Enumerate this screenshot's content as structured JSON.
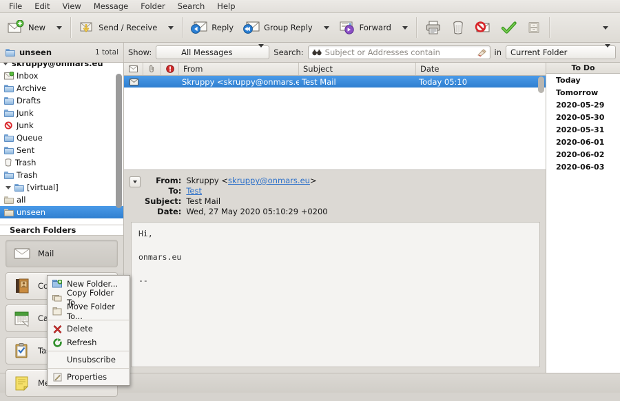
{
  "menubar": {
    "items": [
      {
        "label": "File"
      },
      {
        "label": "Edit"
      },
      {
        "label": "View"
      },
      {
        "label": "Message"
      },
      {
        "label": "Folder"
      },
      {
        "label": "Search"
      },
      {
        "label": "Help"
      }
    ]
  },
  "toolbar": {
    "new_label": "New",
    "send_receive_label": "Send / Receive",
    "reply_label": "Reply",
    "group_reply_label": "Group Reply",
    "forward_label": "Forward",
    "icons": {
      "new": "new-message-icon",
      "send_receive": "send-receive-icon",
      "reply": "reply-icon",
      "group_reply": "group-reply-icon",
      "forward": "forward-icon",
      "print": "print-icon",
      "delete": "trash-icon",
      "junk": "mark-junk-icon",
      "not_junk": "mark-not-junk-icon",
      "archive": "archive-icon",
      "overflow": "toolbar-overflow-icon"
    }
  },
  "filterbar": {
    "folder_name": "unseen",
    "total_label": "1 total",
    "show_label": "Show:",
    "show_value": "All Messages",
    "search_label": "Search:",
    "search_value": "",
    "search_placeholder": "Subject or Addresses contain",
    "in_label": "in",
    "scope_value": "Current Folder"
  },
  "sidebar": {
    "account_label": "skruppy@onmars.eu",
    "folders": [
      {
        "label": "Inbox",
        "indent": 1,
        "icon": "inbox-icon",
        "selected": false
      },
      {
        "label": "Archive",
        "indent": 1,
        "icon": "folder-icon",
        "selected": false
      },
      {
        "label": "Drafts",
        "indent": 1,
        "icon": "folder-icon",
        "selected": false
      },
      {
        "label": "Junk",
        "indent": 1,
        "icon": "folder-icon",
        "selected": false
      },
      {
        "label": "Junk",
        "indent": 1,
        "icon": "junk-icon",
        "selected": false
      },
      {
        "label": "Queue",
        "indent": 1,
        "icon": "folder-icon",
        "selected": false
      },
      {
        "label": "Sent",
        "indent": 1,
        "icon": "folder-icon",
        "selected": false
      },
      {
        "label": "Trash",
        "indent": 1,
        "icon": "trash-icon",
        "selected": false
      },
      {
        "label": "Trash",
        "indent": 1,
        "icon": "folder-icon",
        "selected": false
      },
      {
        "label": "[virtual]",
        "indent": 1,
        "icon": "folder-icon",
        "selected": false,
        "expander": true
      },
      {
        "label": "all",
        "indent": 2,
        "icon": "folder-icon",
        "selected": false
      },
      {
        "label": "unseen",
        "indent": 2,
        "icon": "folder-icon",
        "selected": true
      }
    ],
    "search_folders_label": "Search Folders",
    "modules": [
      {
        "label": "Mail",
        "icon": "mail-icon",
        "active": true
      },
      {
        "label": "Contacts",
        "icon": "contacts-icon",
        "active": false
      },
      {
        "label": "Calendars",
        "icon": "calendar-icon",
        "active": false
      },
      {
        "label": "Tasks",
        "icon": "tasks-icon",
        "active": false
      },
      {
        "label": "Memos",
        "icon": "memos-icon",
        "active": false
      }
    ]
  },
  "message_list": {
    "columns": [
      {
        "label": "",
        "icon": "read-status-icon"
      },
      {
        "label": "",
        "icon": "attachment-icon"
      },
      {
        "label": "",
        "icon": "importance-icon"
      },
      {
        "label": "From"
      },
      {
        "label": "Subject"
      },
      {
        "label": "Date"
      }
    ],
    "rows": [
      {
        "icon": "read-message-icon",
        "from": "Skruppy <skruppy@onmars.eu>",
        "subject": "Test Mail",
        "date": "Today 05:10",
        "selected": true
      }
    ]
  },
  "preview": {
    "headers": [
      {
        "key": "From:",
        "value": "Skruppy <",
        "link": "skruppy@onmars.eu",
        "value_after": ">"
      },
      {
        "key": "To:",
        "link": "Test"
      },
      {
        "key": "Subject:",
        "value": "Test Mail"
      },
      {
        "key": "Date:",
        "value": "Wed, 27 May 2020 05:10:29 +0200"
      }
    ],
    "body": "Hi,\n\nonmars.eu\n\n--"
  },
  "todo": {
    "title": "To Do",
    "items": [
      {
        "label": "Today"
      },
      {
        "label": "Tomorrow"
      },
      {
        "label": "2020-05-29"
      },
      {
        "label": "2020-05-30"
      },
      {
        "label": "2020-05-31"
      },
      {
        "label": "2020-06-01"
      },
      {
        "label": "2020-06-02"
      },
      {
        "label": "2020-06-03"
      }
    ]
  },
  "context_menu": {
    "items": [
      {
        "label": "New Folder...",
        "icon": "new-folder-icon"
      },
      {
        "label": "Copy Folder To...",
        "icon": "copy-folder-icon"
      },
      {
        "label": "Move Folder To...",
        "icon": "move-folder-icon"
      },
      {
        "label": "Delete",
        "icon": "delete-icon"
      },
      {
        "label": "Refresh",
        "icon": "refresh-icon"
      },
      {
        "label": "Unsubscribe",
        "icon": ""
      },
      {
        "label": "Properties",
        "icon": "properties-icon"
      }
    ]
  },
  "statusbar": {
    "icon": "send-receive-complete-icon"
  },
  "colors": {
    "selection": "#2f7fd0",
    "link": "#2a6fc9",
    "chrome": "#dcd9d4"
  }
}
